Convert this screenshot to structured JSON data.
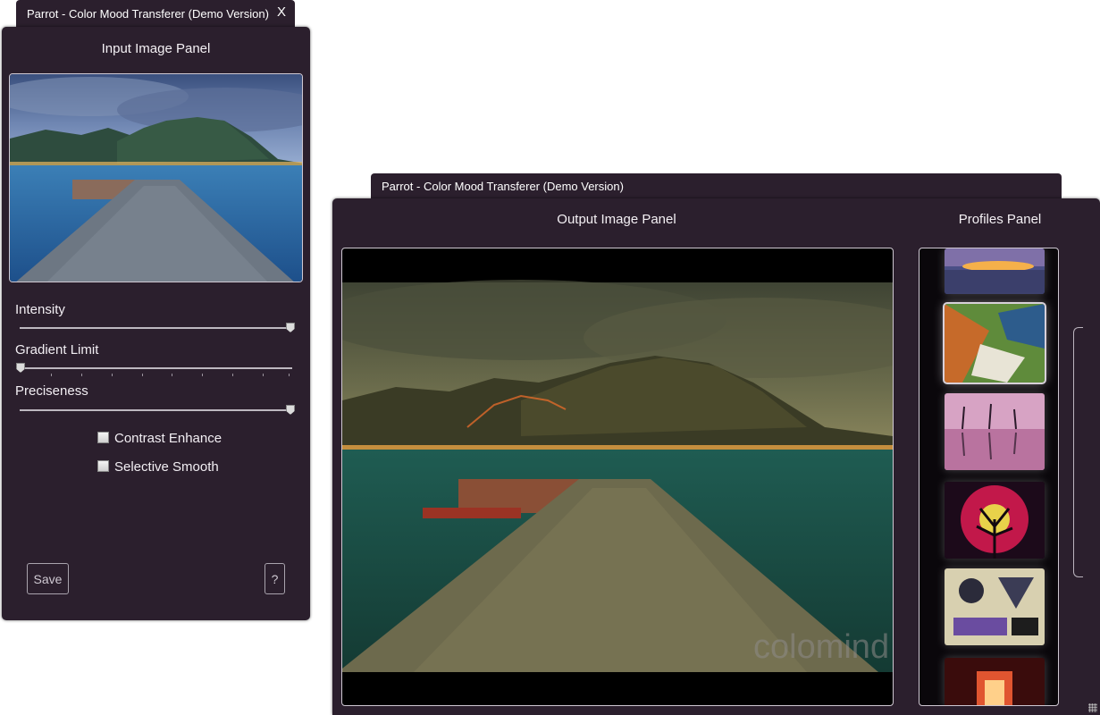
{
  "input_window": {
    "title": "Parrot - Color Mood Transferer (Demo Version)",
    "close_label": "X",
    "panel_title": "Input Image Panel",
    "sliders": [
      {
        "label": "Intensity",
        "value": 1.0
      },
      {
        "label": "Gradient Limit",
        "value": 0.0
      },
      {
        "label": "Preciseness",
        "value": 1.0
      }
    ],
    "checkboxes": [
      {
        "label": "Contrast Enhance",
        "checked": false
      },
      {
        "label": "Selective Smooth",
        "checked": false
      }
    ],
    "save_label": "Save",
    "help_label": "?"
  },
  "output_window": {
    "title": "Parrot - Color Mood Transferer (Demo Version)",
    "output_panel_title": "Output Image Panel",
    "profiles_panel_title": "Profiles Panel",
    "watermark": "colomind"
  },
  "profiles": [
    {
      "name": "sunset-lake-thumbnail",
      "selected": false
    },
    {
      "name": "abstract-painting-thumbnail",
      "selected": true
    },
    {
      "name": "pink-palm-reflection-thumbnail",
      "selected": false
    },
    {
      "name": "red-tree-moon-thumbnail",
      "selected": false
    },
    {
      "name": "kandinsky-composition-thumbnail",
      "selected": false
    },
    {
      "name": "red-fireplace-thumbnail",
      "selected": false
    }
  ],
  "colors": {
    "panel_bg": "#2b1f2d",
    "text": "#ffffff",
    "border": "#cfc8d2"
  }
}
